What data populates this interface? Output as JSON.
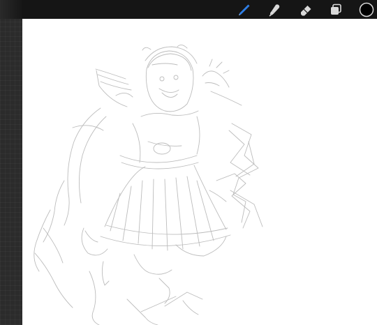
{
  "app": {
    "toolbar": {
      "tools": [
        {
          "name": "brush",
          "icon": "brush-icon",
          "active": true,
          "color": "#2f7fe6"
        },
        {
          "name": "smudge",
          "icon": "smudge-icon",
          "active": false,
          "color": "#d9d9d9"
        },
        {
          "name": "eraser",
          "icon": "eraser-icon",
          "active": false,
          "color": "#d9d9d9"
        },
        {
          "name": "layers",
          "icon": "layers-icon",
          "active": false,
          "color": "#d9d9d9"
        }
      ],
      "current_color": "#000000"
    },
    "canvas": {
      "background": "#ffffff",
      "sketch_color": "#b9b9b9"
    }
  }
}
